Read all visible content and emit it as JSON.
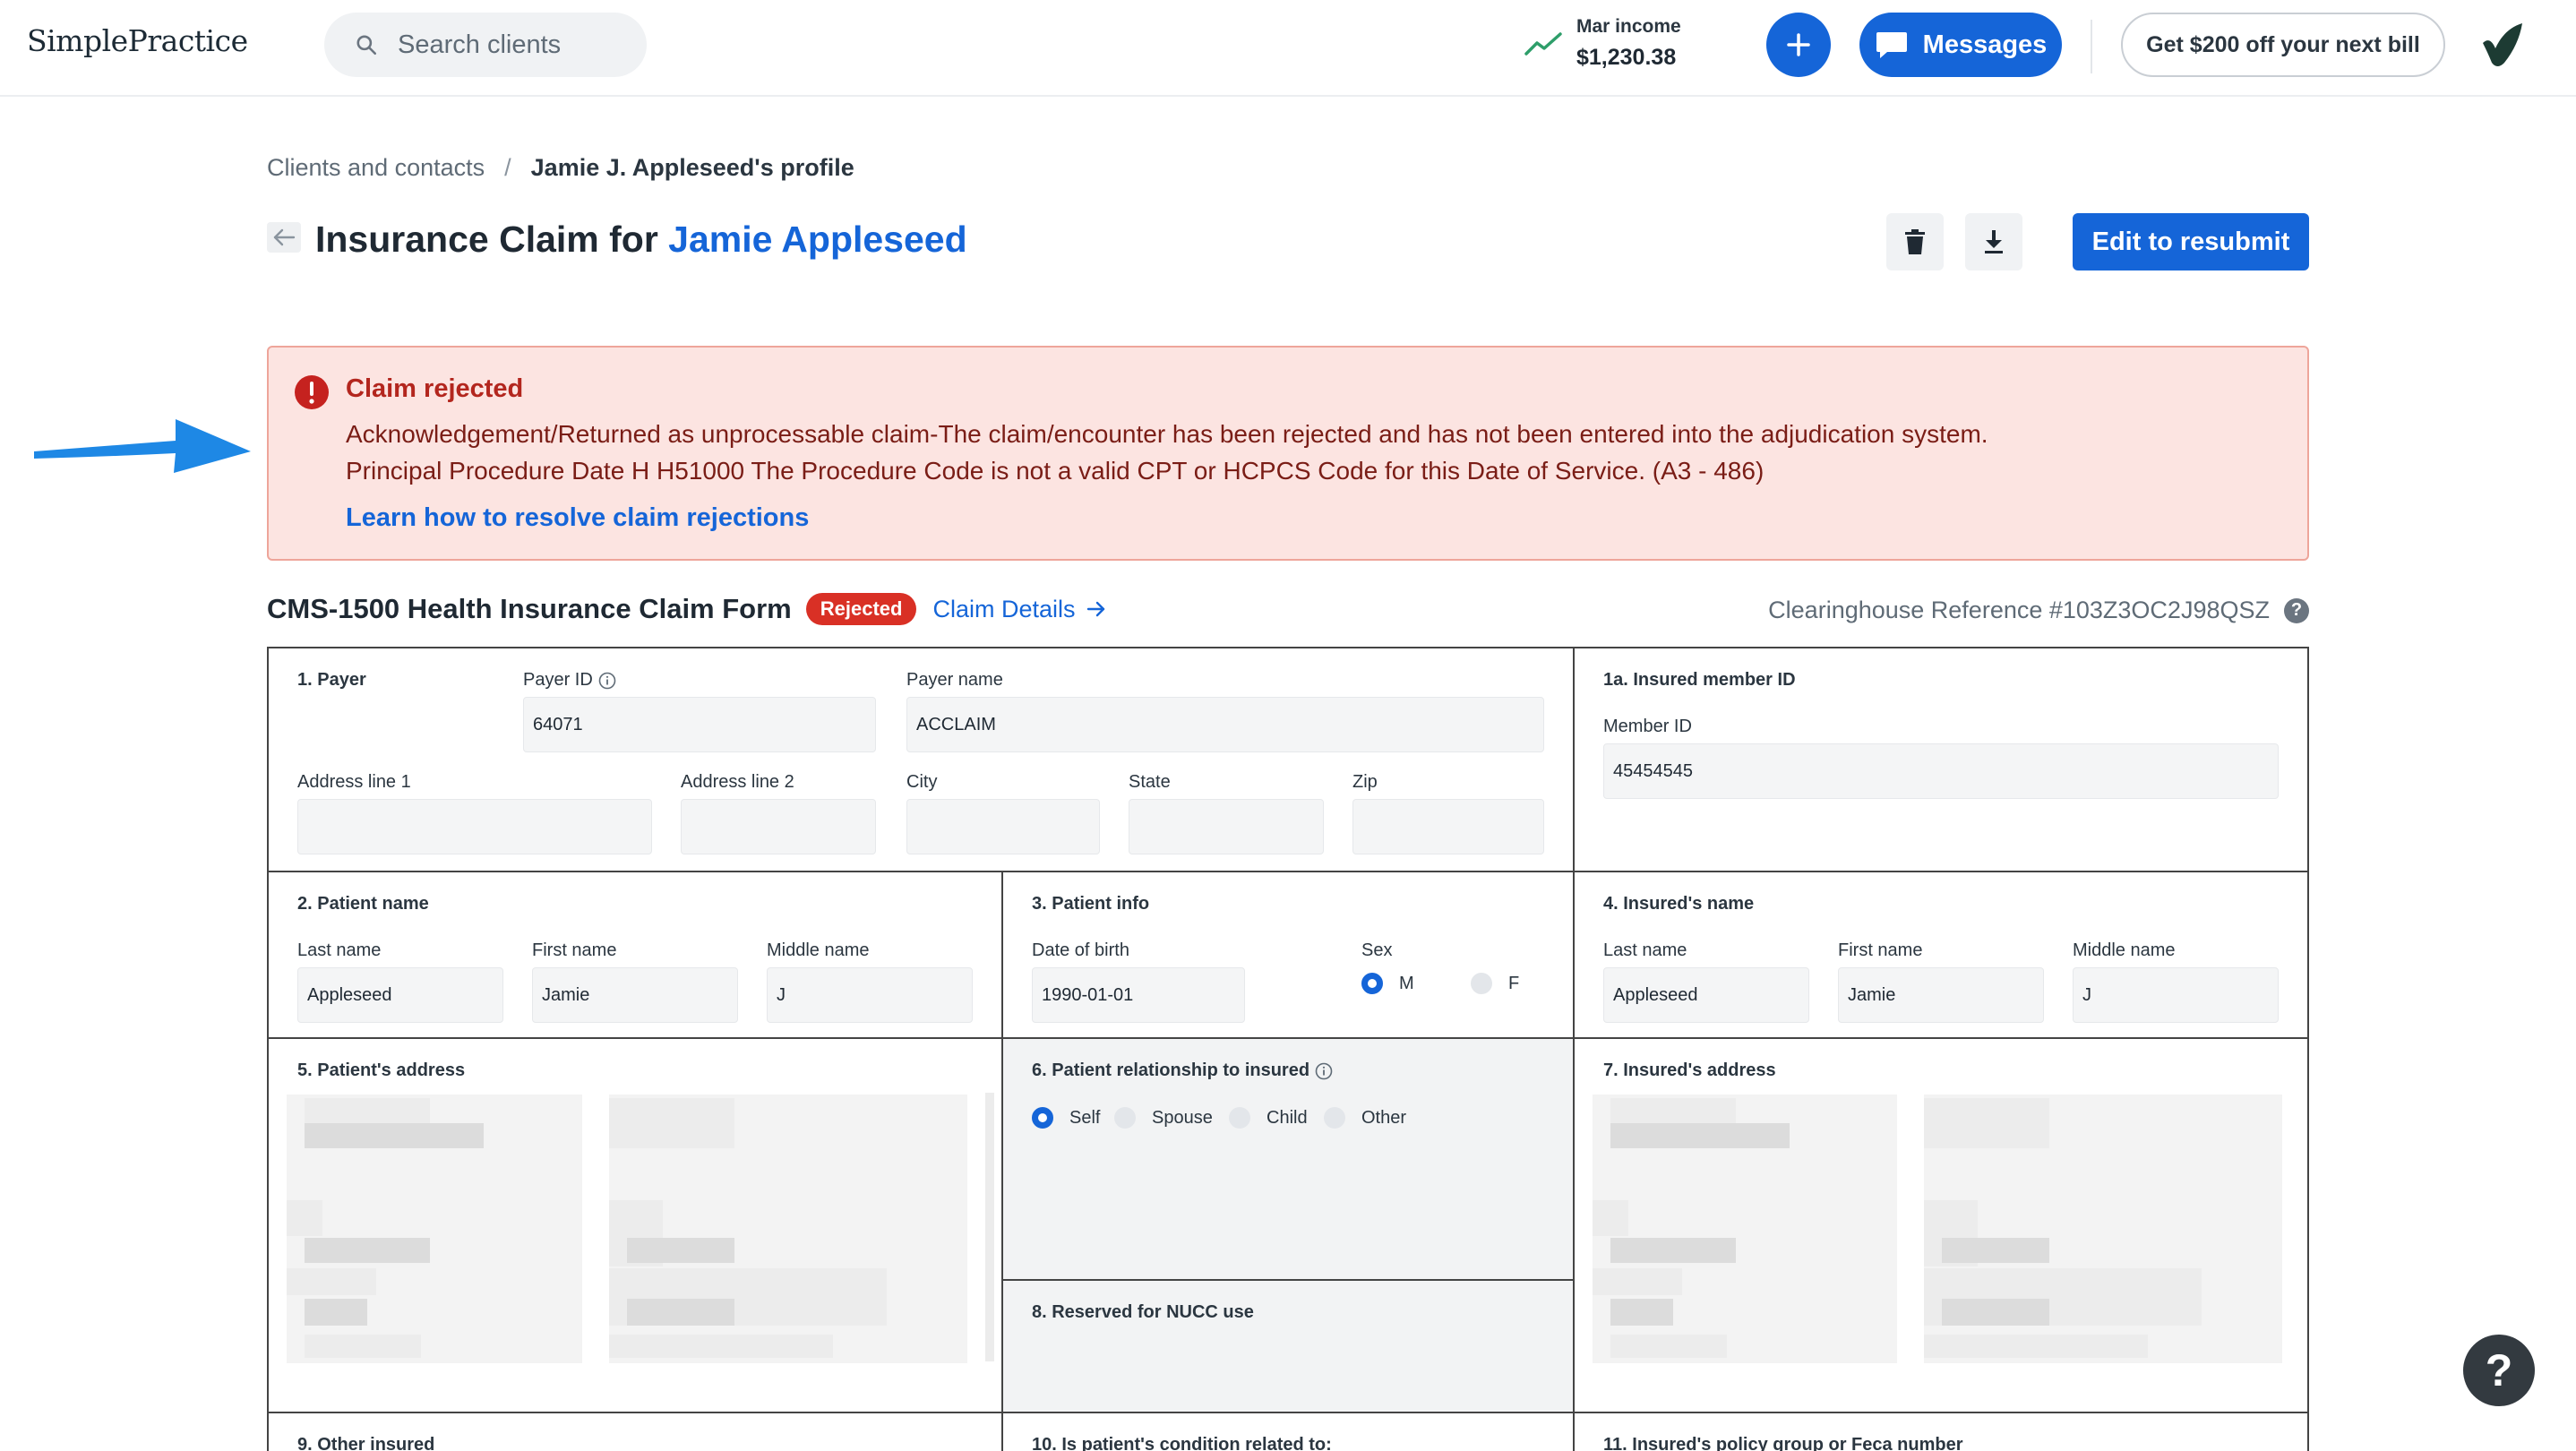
{
  "app": {
    "logo": "SimplePractice"
  },
  "topbar": {
    "search_placeholder": "Search clients",
    "income_label": "Mar income",
    "income_value": "$1,230.38",
    "messages_label": "Messages",
    "promo_label": "Get $200 off your next bill"
  },
  "breadcrumb": {
    "parent": "Clients and contacts",
    "separator": "/",
    "current": "Jamie J. Appleseed's profile"
  },
  "header": {
    "title_prefix": "Insurance Claim for ",
    "client_name": "Jamie Appleseed",
    "resubmit_label": "Edit to resubmit"
  },
  "alert": {
    "title": "Claim rejected",
    "line1": "Acknowledgement/Returned as unprocessable claim-The claim/encounter has been rejected and has not been entered into the adjudication system.",
    "line2": "Principal Procedure Date H H51000 The Procedure Code is not a valid CPT or HCPCS Code for this Date of Service. (A3 - 486)",
    "link": "Learn how to resolve claim rejections"
  },
  "form_header": {
    "title": "CMS-1500 Health Insurance Claim Form",
    "status_badge": "Rejected",
    "claim_details": "Claim Details",
    "clearinghouse": "Clearinghouse Reference #103Z3OC2J98QSZ"
  },
  "form": {
    "payer": {
      "section": "1. Payer",
      "payer_id_label": "Payer ID",
      "payer_id": "64071",
      "payer_name_label": "Payer name",
      "payer_name": "ACCLAIM",
      "address1_label": "Address line 1",
      "address2_label": "Address line 2",
      "city_label": "City",
      "state_label": "State",
      "zip_label": "Zip"
    },
    "insured_id": {
      "section": "1a. Insured member ID",
      "member_id_label": "Member ID",
      "member_id": "45454545"
    },
    "patient_name": {
      "section": "2. Patient name",
      "last_label": "Last name",
      "last": "Appleseed",
      "first_label": "First name",
      "first": "Jamie",
      "middle_label": "Middle name",
      "middle": "J"
    },
    "patient_info": {
      "section": "3. Patient info",
      "dob_label": "Date of birth",
      "dob": "1990-01-01",
      "sex_label": "Sex",
      "sex_m": "M",
      "sex_f": "F"
    },
    "insured_name": {
      "section": "4. Insured's name",
      "last_label": "Last name",
      "last": "Appleseed",
      "first_label": "First name",
      "first": "Jamie",
      "middle_label": "Middle name",
      "middle": "J"
    },
    "patient_address": {
      "section": "5. Patient's address"
    },
    "relationship": {
      "section": "6. Patient relationship to insured",
      "self": "Self",
      "spouse": "Spouse",
      "child": "Child",
      "other": "Other"
    },
    "insured_address": {
      "section": "7. Insured's address"
    },
    "nucc": {
      "section": "8. Reserved for NUCC use"
    },
    "other_insured": {
      "section": "9. Other insured"
    },
    "condition": {
      "section": "10. Is patient's condition related to:"
    },
    "policy_group": {
      "section": "11. Insured's policy group or Feca number"
    }
  },
  "help": {
    "label": "?"
  },
  "colors": {
    "brand_blue": "#1565d8",
    "alert_bg": "#fce4e1",
    "alert_text": "#7a1d16",
    "rejected_red": "#d93025",
    "arrow_blue": "#1e88e5"
  }
}
